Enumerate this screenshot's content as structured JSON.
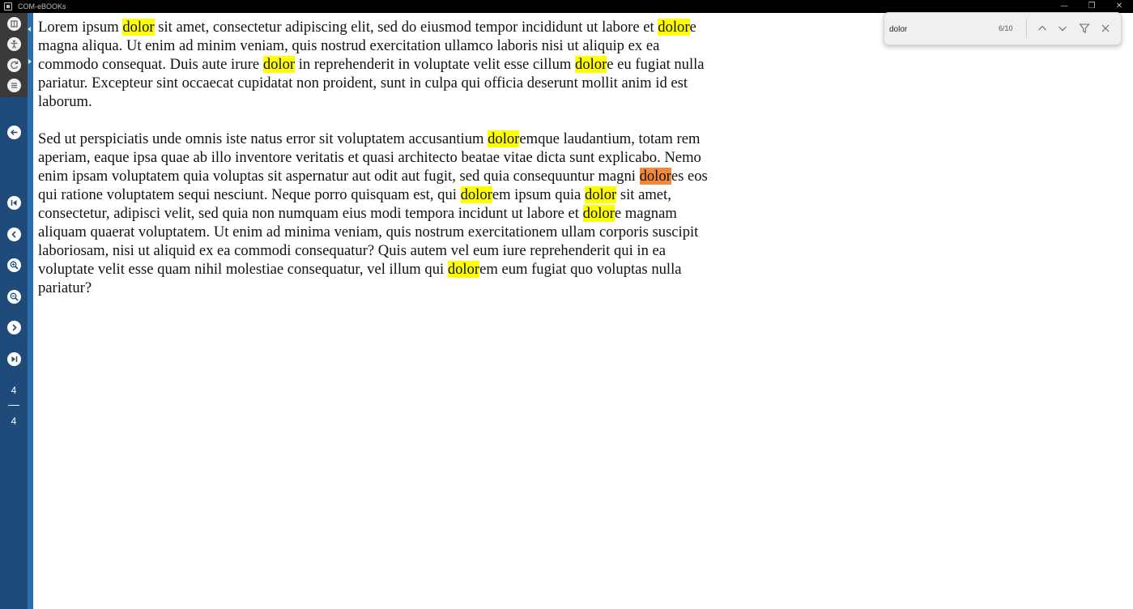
{
  "window": {
    "title": "COM-eBOOKs",
    "minimize_glyph": "—",
    "restore_glyph": "❐",
    "close_glyph": "✕"
  },
  "toolbar": {
    "icons": [
      "book-icon",
      "accessibility-icon",
      "rotate-icon",
      "list-icon",
      "back-icon",
      "first-page-icon",
      "previous-page-icon",
      "zoom-in-icon",
      "zoom-out-icon",
      "next-page-icon",
      "last-page-icon"
    ],
    "current_page": "4",
    "total_pages": "4"
  },
  "find": {
    "query": "dolor",
    "count": "6/10"
  },
  "content": {
    "paragraphs": [
      [
        {
          "t": "Lorem ipsum "
        },
        {
          "h": "dolor"
        },
        {
          "t": " sit amet, consectetur adipiscing elit, sed do eiusmod tempor incididunt ut labore et "
        },
        {
          "h": "dolor"
        },
        {
          "t": "e magna aliqua. Ut enim ad minim veniam, quis nostrud exercitation ullamco laboris nisi ut aliquip ex ea commodo consequat. Duis aute irure "
        },
        {
          "h": "dolor"
        },
        {
          "t": " in reprehenderit in voluptate velit esse cillum "
        },
        {
          "h": "dolor"
        },
        {
          "t": "e eu fugiat nulla pariatur. Excepteur sint occaecat cupidatat non proident, sunt in culpa qui officia deserunt mollit anim id est laborum."
        }
      ],
      [
        {
          "t": "Sed ut perspiciatis unde omnis iste natus error sit voluptatem accusantium "
        },
        {
          "h": "dolor"
        },
        {
          "t": "emque laudantium, totam rem aperiam, eaque ipsa quae ab illo inventore veritatis et quasi architecto beatae vitae dicta sunt explicabo. Nemo enim ipsam voluptatem quia voluptas sit aspernatur aut odit aut fugit, sed quia consequuntur magni "
        },
        {
          "c": "dolor"
        },
        {
          "t": "es eos qui ratione voluptatem sequi nesciunt. Neque porro quisquam est, qui "
        },
        {
          "h": "dolor"
        },
        {
          "t": "em ipsum quia "
        },
        {
          "h": "dolor"
        },
        {
          "t": " sit amet, consectetur, adipisci velit, sed quia non numquam eius modi tempora incidunt ut labore et "
        },
        {
          "h": "dolor"
        },
        {
          "t": "e magnam aliquam quaerat voluptatem. Ut enim ad minima veniam, quis nostrum exercitationem ullam corporis suscipit laboriosam, nisi ut aliquid ex ea commodi consequatur? Quis autem vel eum iure reprehenderit qui in ea voluptate velit esse quam nihil molestiae consequatur, vel illum qui "
        },
        {
          "h": "dolor"
        },
        {
          "t": "em eum fugiat quo voluptas nulla pariatur?"
        }
      ]
    ]
  },
  "colors": {
    "highlight": "#ffff00",
    "current_highlight": "#f2893a",
    "sidebar": "#1f4b7b",
    "accent": "#2d6ea8"
  }
}
